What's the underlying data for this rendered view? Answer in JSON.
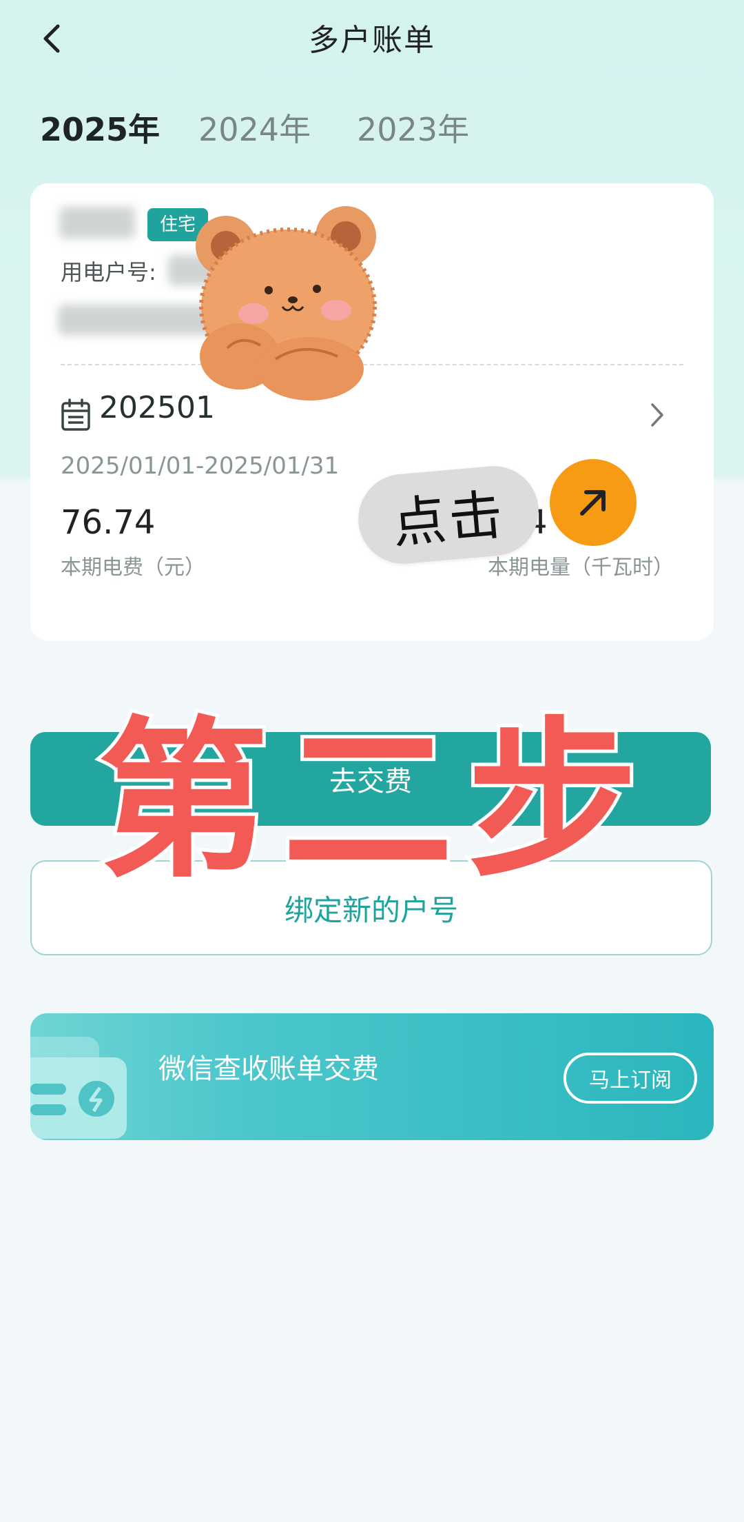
{
  "header": {
    "title": "多户账单"
  },
  "year_tabs": [
    {
      "label": "2025年",
      "active": true
    },
    {
      "label": "2024年",
      "active": false
    },
    {
      "label": "2023年",
      "active": false
    }
  ],
  "bill_card": {
    "account_type_tag": "住宅",
    "account_number_label": "用电户号:",
    "period": "202501",
    "date_range": "2025/01/01-2025/01/31",
    "fee_value": "76.74",
    "fee_label": "本期电费（元）",
    "usage_value_partial": "4",
    "usage_label": "本期电量（千瓦时）"
  },
  "overlay": {
    "click_sticker_text": "点击",
    "step_text": "第二步"
  },
  "actions": {
    "pay_label": "去交费",
    "bind_label": "绑定新的户号"
  },
  "wechat_banner": {
    "text": "微信查收账单交费",
    "subscribe_label": "马上订阅"
  },
  "colors": {
    "accent": "#22a69f",
    "overlay_red": "#f15a55",
    "arrow_orange": "#f79a14"
  }
}
